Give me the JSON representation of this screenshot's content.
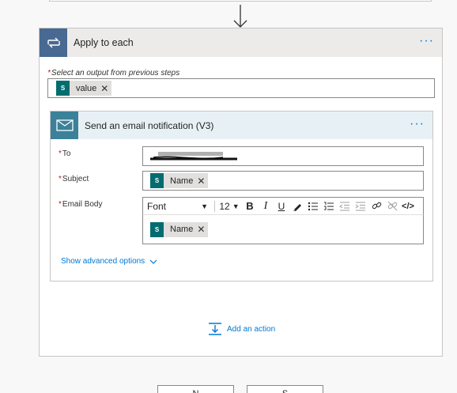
{
  "apply_to_each": {
    "title": "Apply to each",
    "more_label": "···",
    "select_label": "Select an output from previous steps",
    "required_mark": "*",
    "token": {
      "label": "value",
      "remove": "✕",
      "icon": "sharepoint-icon"
    }
  },
  "email_action": {
    "title": "Send an email notification (V3)",
    "more_label": "···",
    "fields": {
      "to_label": "To",
      "subject_label": "Subject",
      "body_label": "Email Body"
    },
    "subject_token": {
      "label": "Name",
      "remove": "✕",
      "icon": "sharepoint-icon"
    },
    "body_token": {
      "label": "Name",
      "remove": "✕",
      "icon": "sharepoint-icon"
    },
    "toolbar": {
      "font": "Font",
      "size": "12",
      "bold": "B",
      "italic": "I",
      "underline": "U",
      "code": "</>"
    },
    "advanced_label": "Show advanced options"
  },
  "add_action_label": "Add an action",
  "bottom_buttons": [
    "N",
    "S"
  ],
  "colors": {
    "accent": "#0078d4",
    "apply_icon_bg": "#486991",
    "email_icon_bg": "#3b8199",
    "token_icon_bg": "#036c70",
    "required": "#a4262c"
  }
}
